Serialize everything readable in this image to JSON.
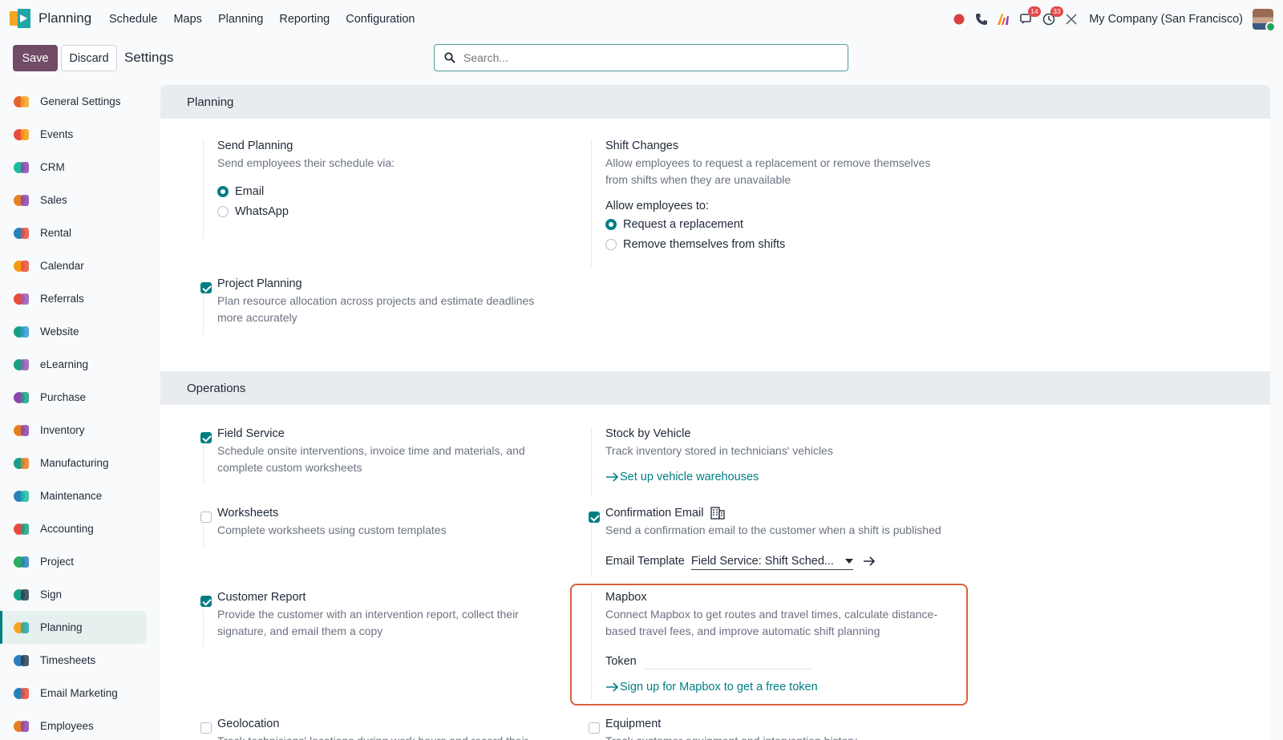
{
  "navbar": {
    "app_name": "Planning",
    "menu": [
      "Schedule",
      "Maps",
      "Planning",
      "Reporting",
      "Configuration"
    ],
    "chat_badge": "14",
    "activity_badge": "33",
    "company": "My Company (San Francisco)"
  },
  "control": {
    "save_label": "Save",
    "discard_label": "Discard",
    "title": "Settings",
    "search_placeholder": "Search..."
  },
  "sidebar": {
    "items": [
      {
        "label": "General Settings",
        "icon": "general-settings-icon"
      },
      {
        "label": "Events",
        "icon": "events-icon"
      },
      {
        "label": "CRM",
        "icon": "crm-icon"
      },
      {
        "label": "Sales",
        "icon": "sales-icon"
      },
      {
        "label": "Rental",
        "icon": "rental-icon"
      },
      {
        "label": "Calendar",
        "icon": "calendar-icon"
      },
      {
        "label": "Referrals",
        "icon": "referrals-icon"
      },
      {
        "label": "Website",
        "icon": "website-icon"
      },
      {
        "label": "eLearning",
        "icon": "elearning-icon"
      },
      {
        "label": "Purchase",
        "icon": "purchase-icon"
      },
      {
        "label": "Inventory",
        "icon": "inventory-icon"
      },
      {
        "label": "Manufacturing",
        "icon": "manufacturing-icon"
      },
      {
        "label": "Maintenance",
        "icon": "maintenance-icon"
      },
      {
        "label": "Accounting",
        "icon": "accounting-icon"
      },
      {
        "label": "Project",
        "icon": "project-icon"
      },
      {
        "label": "Sign",
        "icon": "sign-icon"
      },
      {
        "label": "Planning",
        "icon": "planning-icon"
      },
      {
        "label": "Timesheets",
        "icon": "timesheets-icon"
      },
      {
        "label": "Email Marketing",
        "icon": "email-marketing-icon"
      },
      {
        "label": "Employees",
        "icon": "employees-icon"
      }
    ],
    "active": "Planning"
  },
  "planning": {
    "heading": "Planning",
    "send_planning": {
      "title": "Send Planning",
      "desc": "Send employees their schedule via:",
      "options": [
        "Email",
        "WhatsApp"
      ],
      "selected": "Email"
    },
    "shift_changes": {
      "title": "Shift Changes",
      "desc": "Allow employees to request a replacement or remove themselves from shifts when they are unavailable",
      "allow_label": "Allow employees to:",
      "options": [
        "Request a replacement",
        "Remove themselves from shifts"
      ],
      "selected": "Request a replacement"
    },
    "project_planning": {
      "title": "Project Planning",
      "desc": "Plan resource allocation across projects and estimate deadlines more accurately",
      "checked": true
    }
  },
  "operations": {
    "heading": "Operations",
    "field_service": {
      "title": "Field Service",
      "desc": "Schedule onsite interventions, invoice time and materials, and complete custom worksheets",
      "checked": true
    },
    "stock_by_vehicle": {
      "title": "Stock by Vehicle",
      "desc": "Track inventory stored in technicians' vehicles",
      "link": "Set up vehicle warehouses"
    },
    "worksheets": {
      "title": "Worksheets",
      "desc": "Complete worksheets using custom templates",
      "checked": false
    },
    "confirmation_email": {
      "title": "Confirmation Email",
      "desc": "Send a confirmation email to the customer when a shift is published",
      "template_label": "Email Template",
      "template_value": "Field Service: Shift Sched...",
      "checked": true
    },
    "customer_report": {
      "title": "Customer Report",
      "desc": "Provide the customer with an intervention report, collect their signature, and email them a copy",
      "checked": true
    },
    "mapbox": {
      "title": "Mapbox",
      "desc": "Connect Mapbox to get routes and travel times, calculate distance-based travel fees, and improve automatic shift planning",
      "token_label": "Token",
      "link": "Sign up for Mapbox to get a free token"
    },
    "geolocation": {
      "title": "Geolocation",
      "desc": "Track technicians' locations during work hours and record their",
      "checked": false
    },
    "equipment": {
      "title": "Equipment",
      "desc": "Track customer equipment and intervention history",
      "checked": false
    }
  },
  "colors": {
    "primary": "#714b67",
    "accent": "#017e84",
    "highlight": "#d9603b"
  }
}
